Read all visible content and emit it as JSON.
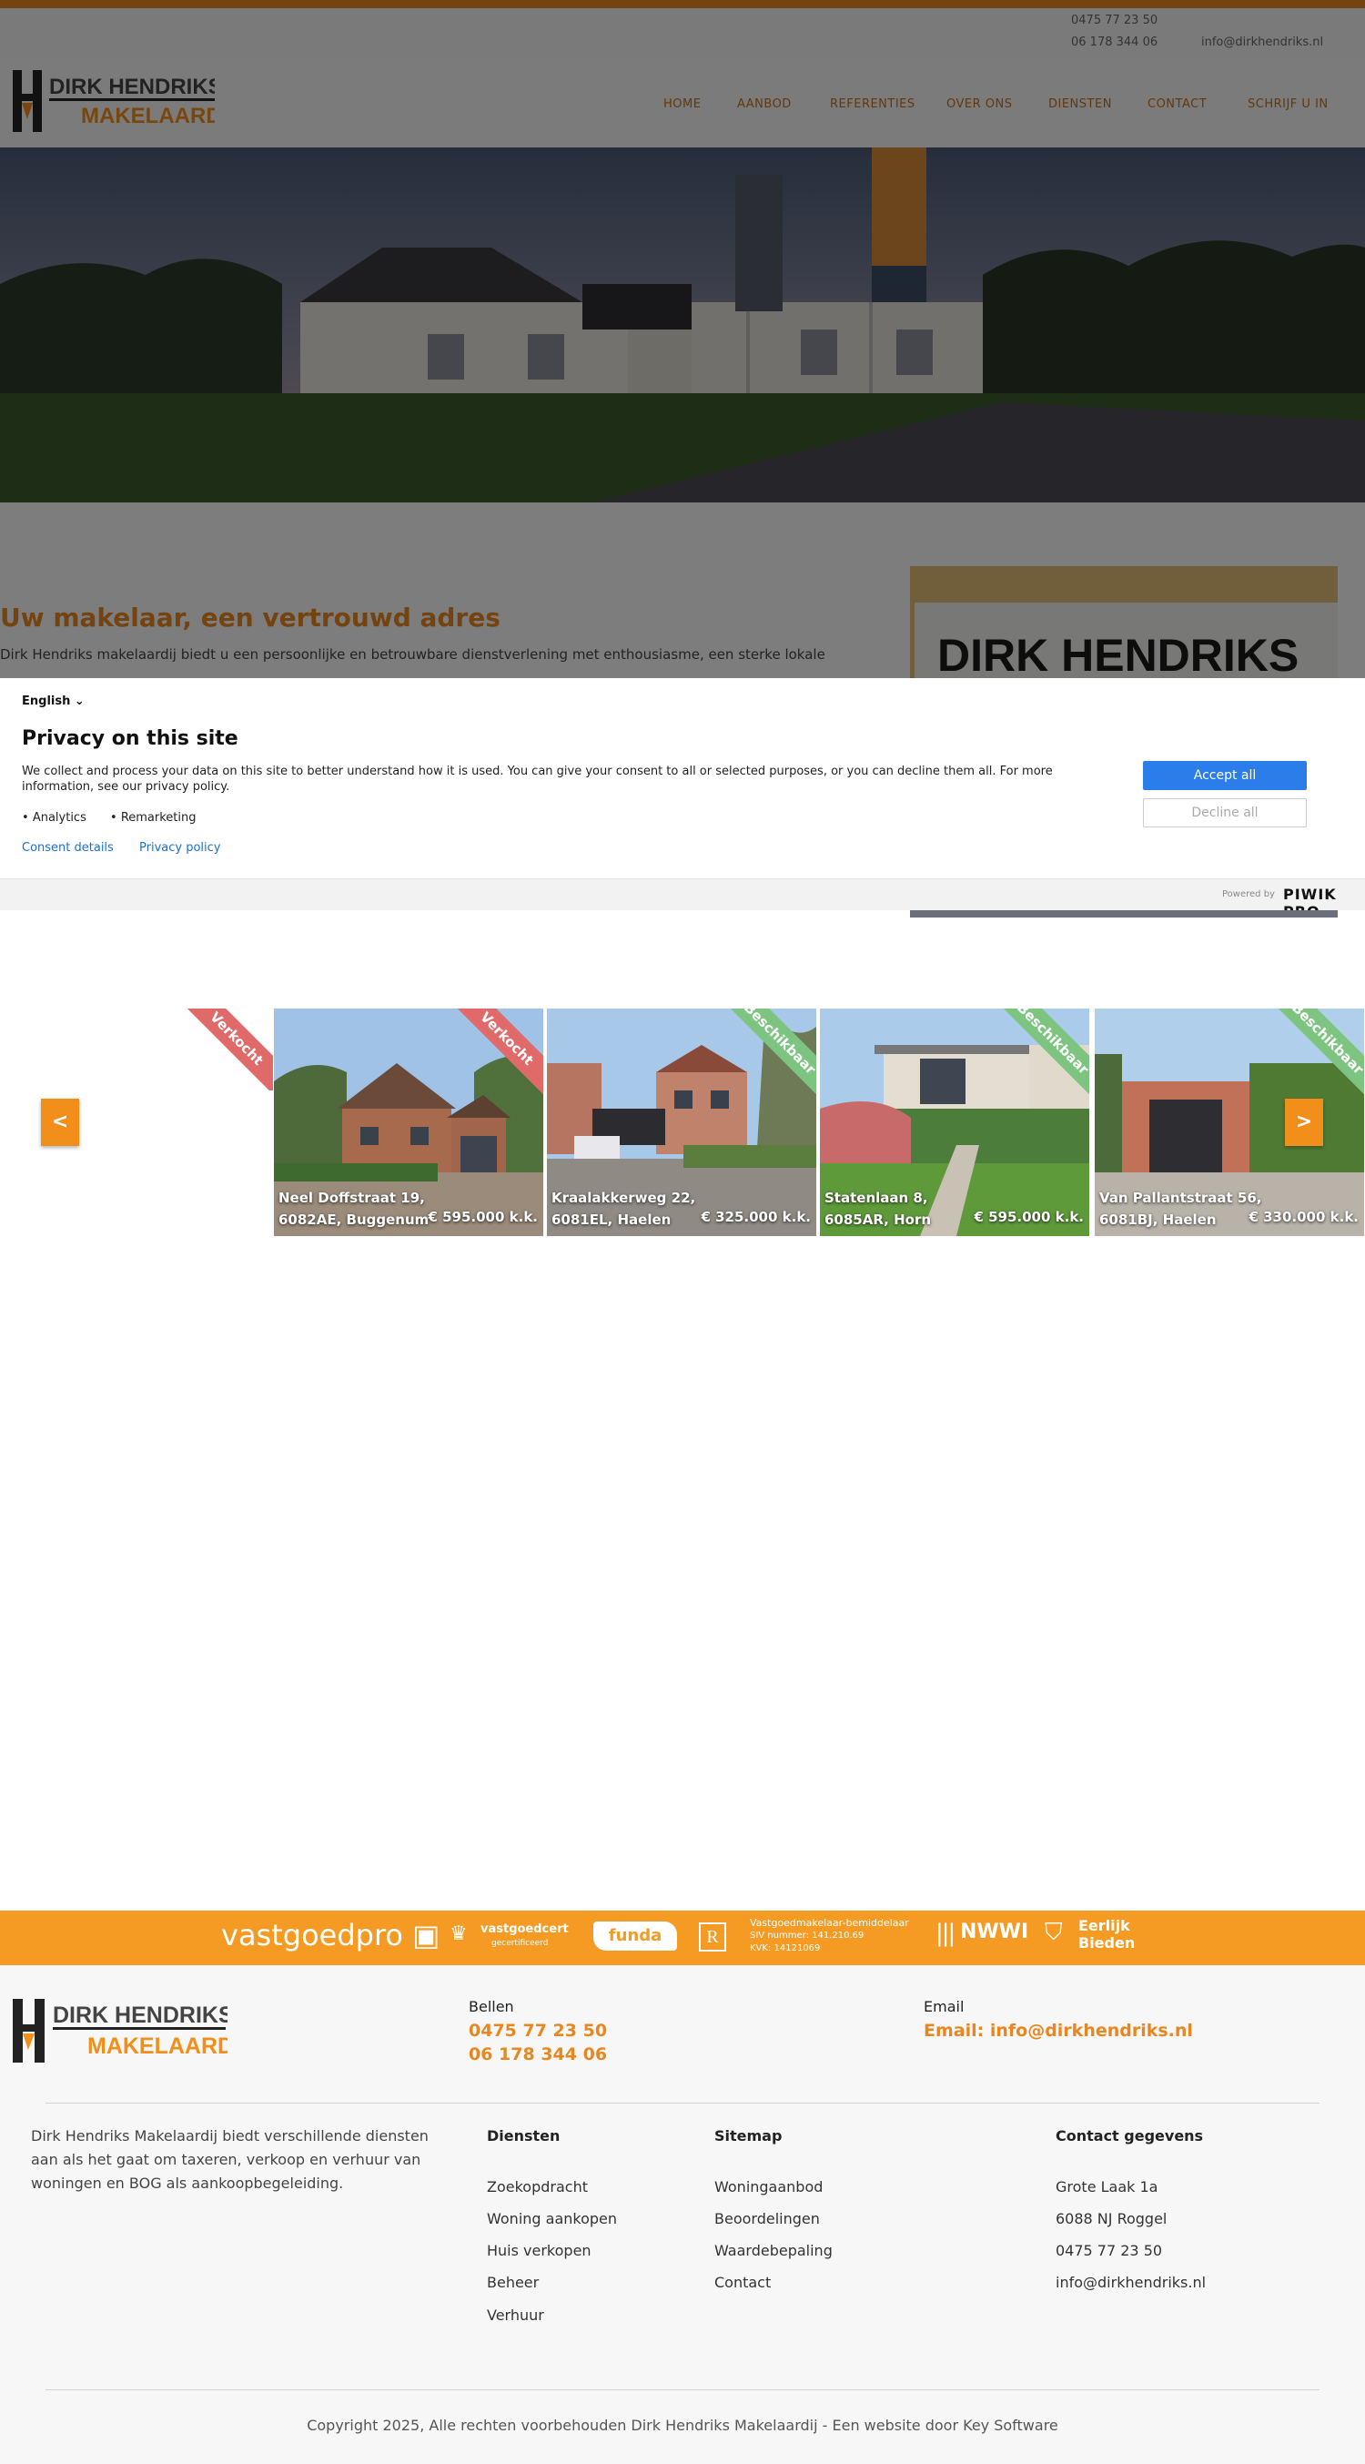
{
  "topbar": {
    "phone1": "0475 77 23 50",
    "phone2": "06 178 344 06",
    "email": "info@dirkhendriks.nl"
  },
  "brand": {
    "name_line1": "DIRK HENDRIKS",
    "name_line2": "MAKELAARDIJ"
  },
  "nav": {
    "items": [
      "HOME",
      "AANBOD",
      "REFERENTIES",
      "OVER ONS",
      "DIENSTEN",
      "CONTACT",
      "SCHRIJF U IN"
    ]
  },
  "intro": {
    "title": "Uw makelaar, een vertrouwd adres",
    "text": "Dirk Hendriks makelaardij biedt u een persoonlijke en betrouwbare dienstverlening met enthousiasme, een sterke lokale",
    "sign_text": "DIRK HENDRIKS"
  },
  "consent": {
    "language": "English",
    "title": "Privacy on this site",
    "description": "We collect and process your data on this site to better understand how it is used. You can give your consent to all or selected purposes, or you can decline them all. For more information, see our privacy policy.",
    "purposes": [
      "Analytics",
      "Remarketing"
    ],
    "consent_details": "Consent details",
    "privacy_policy": "Privacy policy",
    "accept_all": "Accept all",
    "decline_all": "Decline all",
    "powered_by": "Powered by",
    "powered_brand": "PIWIK PRO"
  },
  "slider": {
    "prev_label": "<",
    "next_label": ">",
    "first_ribbon": "Verkocht",
    "listings": [
      {
        "street": "Neel Doffstraat 19,",
        "city": "6082AE, Buggenum",
        "price": "€ 595.000 k.k.",
        "status": "Verkocht"
      },
      {
        "street": "Kraalakkerweg 22,",
        "city": "6081EL, Haelen",
        "price": "€ 325.000 k.k.",
        "status": "Beschikbaar"
      },
      {
        "street": "Statenlaan 8,",
        "city": "6085AR, Horn",
        "price": "€ 595.000 k.k.",
        "status": "Beschikbaar"
      },
      {
        "street": "Van Pallantstraat 56,",
        "city": "6081BJ, Haelen",
        "price": "€ 330.000 k.k.",
        "status": "Beschikbaar"
      }
    ]
  },
  "partners": {
    "vastgoedpro": "vastgoedpro",
    "vastgoedcert": "vastgoedcert",
    "vastgoedcert_sub": "gecertificeerd",
    "funda": "funda",
    "register_mark": "R",
    "bemiddelaar_line1": "Vastgoedmakelaar-bemiddelaar",
    "bemiddelaar_line2": "SIV nummer: 141.210.69",
    "bemiddelaar_line3": "KVK: 14121069",
    "nwwi": "NWWI",
    "eerlijk_line1": "Eerlijk",
    "eerlijk_line2": "Bieden"
  },
  "footer": {
    "bellen_label": "Bellen",
    "phone1": "0475 77 23 50",
    "phone2": "06 178 344 06",
    "email_label": "Email",
    "email_value": "Email: info@dirkhendriks.nl",
    "about": "Dirk Hendriks Makelaardij biedt verschillende diensten aan als het gaat om taxeren, verkoop en verhuur van woningen en BOG als aankoopbegeleiding.",
    "diensten_title": "Diensten",
    "diensten": [
      "Zoekopdracht",
      "Woning aankopen",
      "Huis verkopen",
      "Beheer",
      "Verhuur"
    ],
    "sitemap_title": "Sitemap",
    "sitemap": [
      "Woningaanbod",
      "Beoordelingen",
      "Waardebepaling",
      "Contact"
    ],
    "contact_title": "Contact gegevens",
    "contact": [
      "Grote Laak 1a",
      "6088 NJ Roggel",
      "0475 77 23 50",
      "info@dirkhendriks.nl"
    ],
    "copyright": "Copyright 2025, Alle rechten voorbehouden Dirk Hendriks Makelaardij - Een website door Key Software"
  },
  "colors": {
    "brand_orange": "#e8871f",
    "partner_bar": "#f59a23",
    "accept_blue": "#2b7de9",
    "sold_red": "#e06a6a",
    "available_green": "#7cc47f"
  }
}
